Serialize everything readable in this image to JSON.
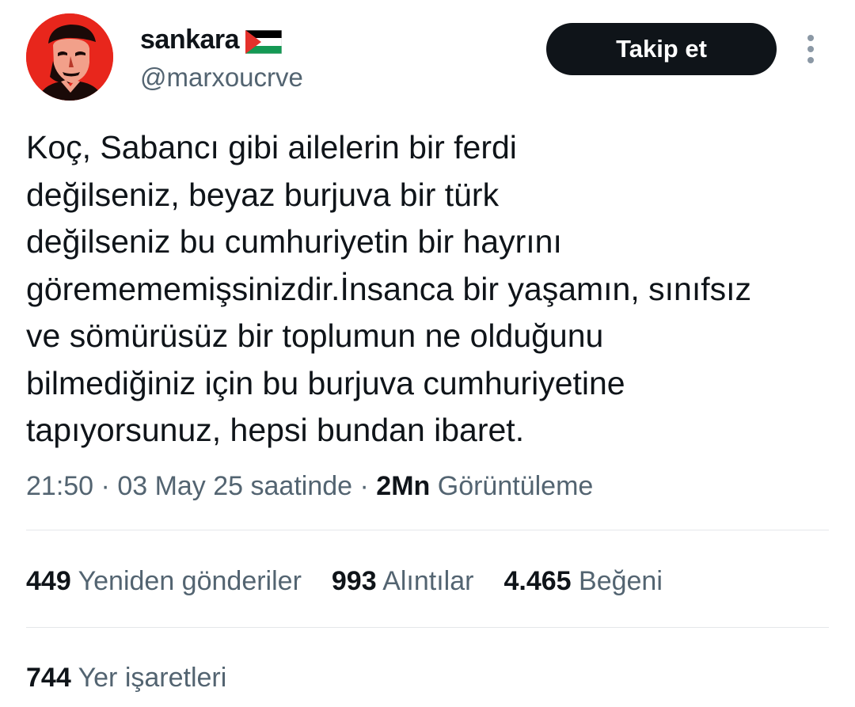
{
  "author": {
    "display_name": "sankara",
    "flag_icon": "palestine-flag-icon",
    "handle": "@marxoucrve",
    "avatar_color": "#e8261c"
  },
  "follow_button": {
    "label": "Takip et"
  },
  "more_icon": "more-vertical-icon",
  "tweet": {
    "text": "Koç, Sabancı gibi ailelerin bir ferdi\ndeğilseniz, beyaz burjuva bir türk\ndeğilseniz bu cumhuriyetin bir hayrını\ngöremememişsinizdir.İnsanca bir yaşamın, sınıfsız\nve sömürüsüz bir toplumun ne olduğunu\nbilmediğiniz için bu burjuva cumhuriyetine\ntapıyorsunuz, hepsi bundan ibaret."
  },
  "meta": {
    "time": "21:50",
    "date": "03 May 25 saatinde",
    "views_count": "2Mn",
    "views_label": "Görüntüleme",
    "separator": " · "
  },
  "stats": {
    "reposts": {
      "count": "449",
      "label": "Yeniden gönderiler"
    },
    "quotes": {
      "count": "993",
      "label": "Alıntılar"
    },
    "likes": {
      "count": "4.465",
      "label": "Beğeni"
    },
    "bookmarks": {
      "count": "744",
      "label": "Yer işaretleri"
    }
  },
  "colors": {
    "text_primary": "#0f1419",
    "text_secondary": "#536471",
    "button_bg": "#0f1419",
    "divider": "#e4e7ea"
  }
}
